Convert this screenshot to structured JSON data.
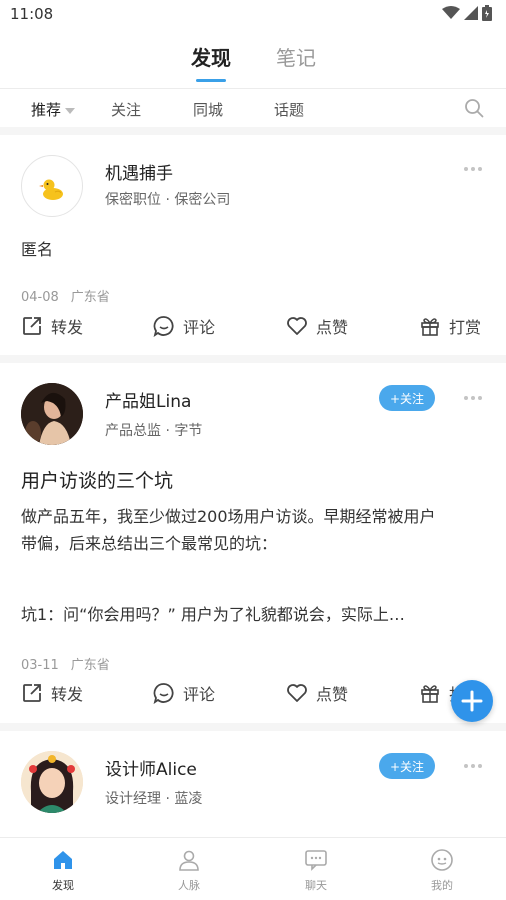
{
  "status_bar": {
    "time": "11:08"
  },
  "top_tabs": {
    "active": "发现",
    "inactive": "笔记"
  },
  "sub_nav": {
    "items": [
      "推荐",
      "关注",
      "同城",
      "话题"
    ]
  },
  "posts": [
    {
      "author": "机遇捕手",
      "subtitle": "保密职位 · 保密公司",
      "body": "匿名",
      "date": "04-08",
      "location": "广东省",
      "actions": {
        "share": "转发",
        "comment": "评论",
        "like": "点赞",
        "reward": "打赏"
      }
    },
    {
      "author": "产品姐Lina",
      "subtitle": "产品总监 · 字节",
      "follow": "+关注",
      "title": "用户访谈的三个坑",
      "body_lines": [
        "做产品五年，我至少做过200场用户访谈。早期经常被用户",
        "带偏，后来总结出三个最常见的坑：",
        "",
        "坑1：问“你会用吗？” 用户为了礼貌都说会，实际上…"
      ],
      "date": "03-11",
      "location": "广东省",
      "actions": {
        "share": "转发",
        "comment": "评论",
        "like": "点赞",
        "reward": "打赏"
      }
    },
    {
      "author": "设计师Alice",
      "subtitle": "设计经理 · 蓝凌",
      "follow": "+关注"
    }
  ],
  "bottom_nav": {
    "items": [
      "发现",
      "人脉",
      "聊天",
      "我的"
    ]
  },
  "colors": {
    "accent": "#3aa0e8",
    "follow": "#4aa8ec",
    "fab": "#2f93ea"
  },
  "icons": [
    "wifi-icon",
    "signal-icon",
    "battery-icon",
    "search-icon",
    "more-icon",
    "share-icon",
    "comment-icon",
    "heart-icon",
    "gift-icon",
    "plus-icon",
    "home-icon",
    "person-icon",
    "chat-icon",
    "profile-icon"
  ]
}
